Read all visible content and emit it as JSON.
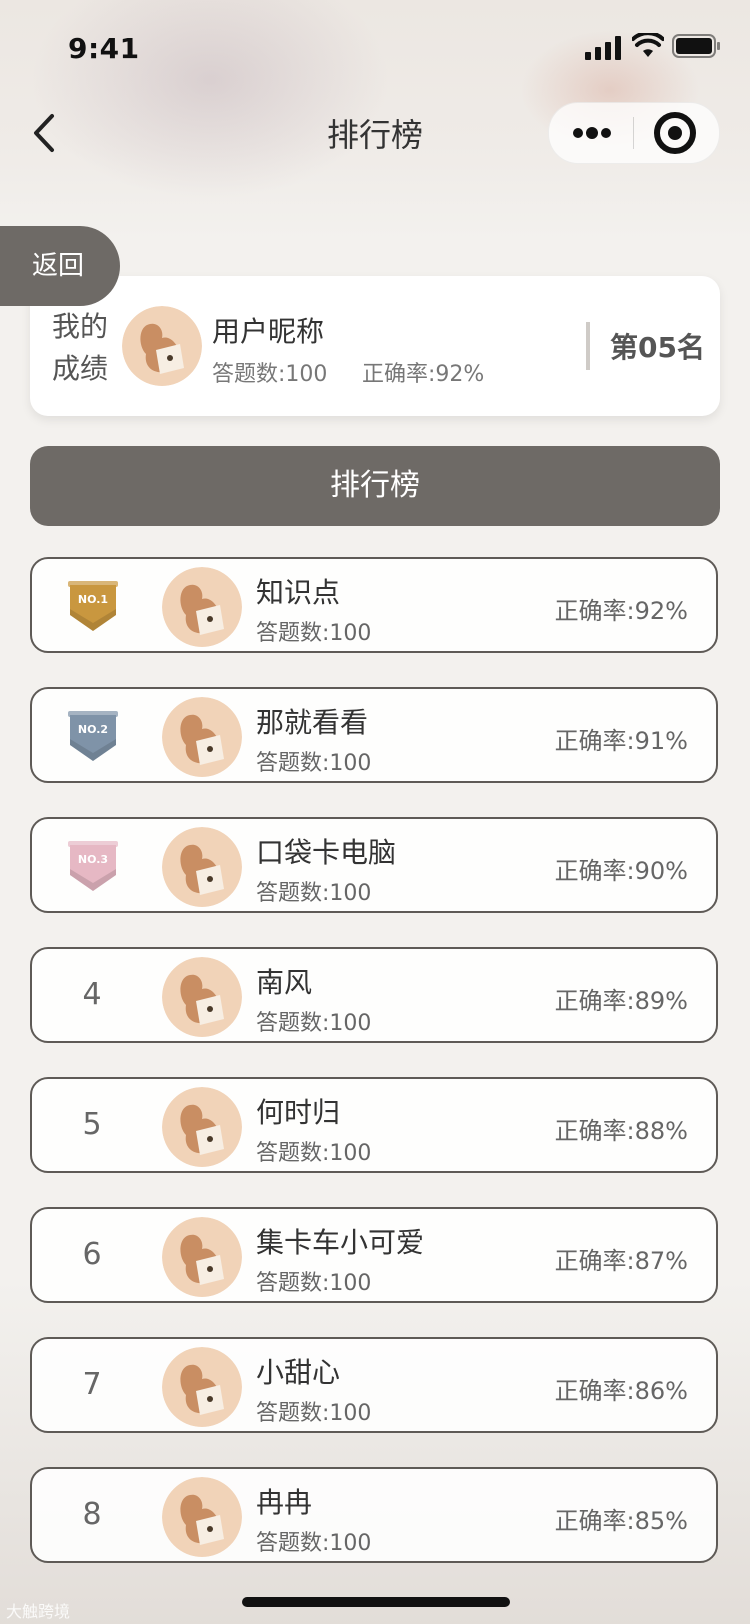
{
  "status_bar": {
    "time": "9:41"
  },
  "nav": {
    "title": "排行榜"
  },
  "return_label": "返回",
  "my_score": {
    "label_line1": "我的",
    "label_line2": "成绩",
    "name": "用户昵称",
    "answers": "答题数:100",
    "accuracy": "正确率:92%",
    "rank": "第05名"
  },
  "ranking_header": "排行榜",
  "rows": [
    {
      "rank": "1",
      "medal": "NO.1",
      "name": "知识点",
      "answers": "答题数:100",
      "accuracy": "正确率:92%"
    },
    {
      "rank": "2",
      "medal": "NO.2",
      "name": "那就看看",
      "answers": "答题数:100",
      "accuracy": "正确率:91%"
    },
    {
      "rank": "3",
      "medal": "NO.3",
      "name": "口袋卡电脑",
      "answers": "答题数:100",
      "accuracy": "正确率:90%"
    },
    {
      "rank": "4",
      "name": "南风",
      "answers": "答题数:100",
      "accuracy": "正确率:89%"
    },
    {
      "rank": "5",
      "name": "何时归",
      "answers": "答题数:100",
      "accuracy": "正确率:88%"
    },
    {
      "rank": "6",
      "name": "集卡车小可爱",
      "answers": "答题数:100",
      "accuracy": "正确率:87%"
    },
    {
      "rank": "7",
      "name": "小甜心",
      "answers": "答题数:100",
      "accuracy": "正确率:86%"
    },
    {
      "rank": "8",
      "name": "冉冉",
      "answers": "答题数:100",
      "accuracy": "正确率:85%"
    }
  ],
  "medal_colors": {
    "gold": "#c9973f",
    "silver": "#7f93a8",
    "bronze": "#e6b8c4"
  },
  "accent": "#6e6a66",
  "watermark": "大触跨境"
}
